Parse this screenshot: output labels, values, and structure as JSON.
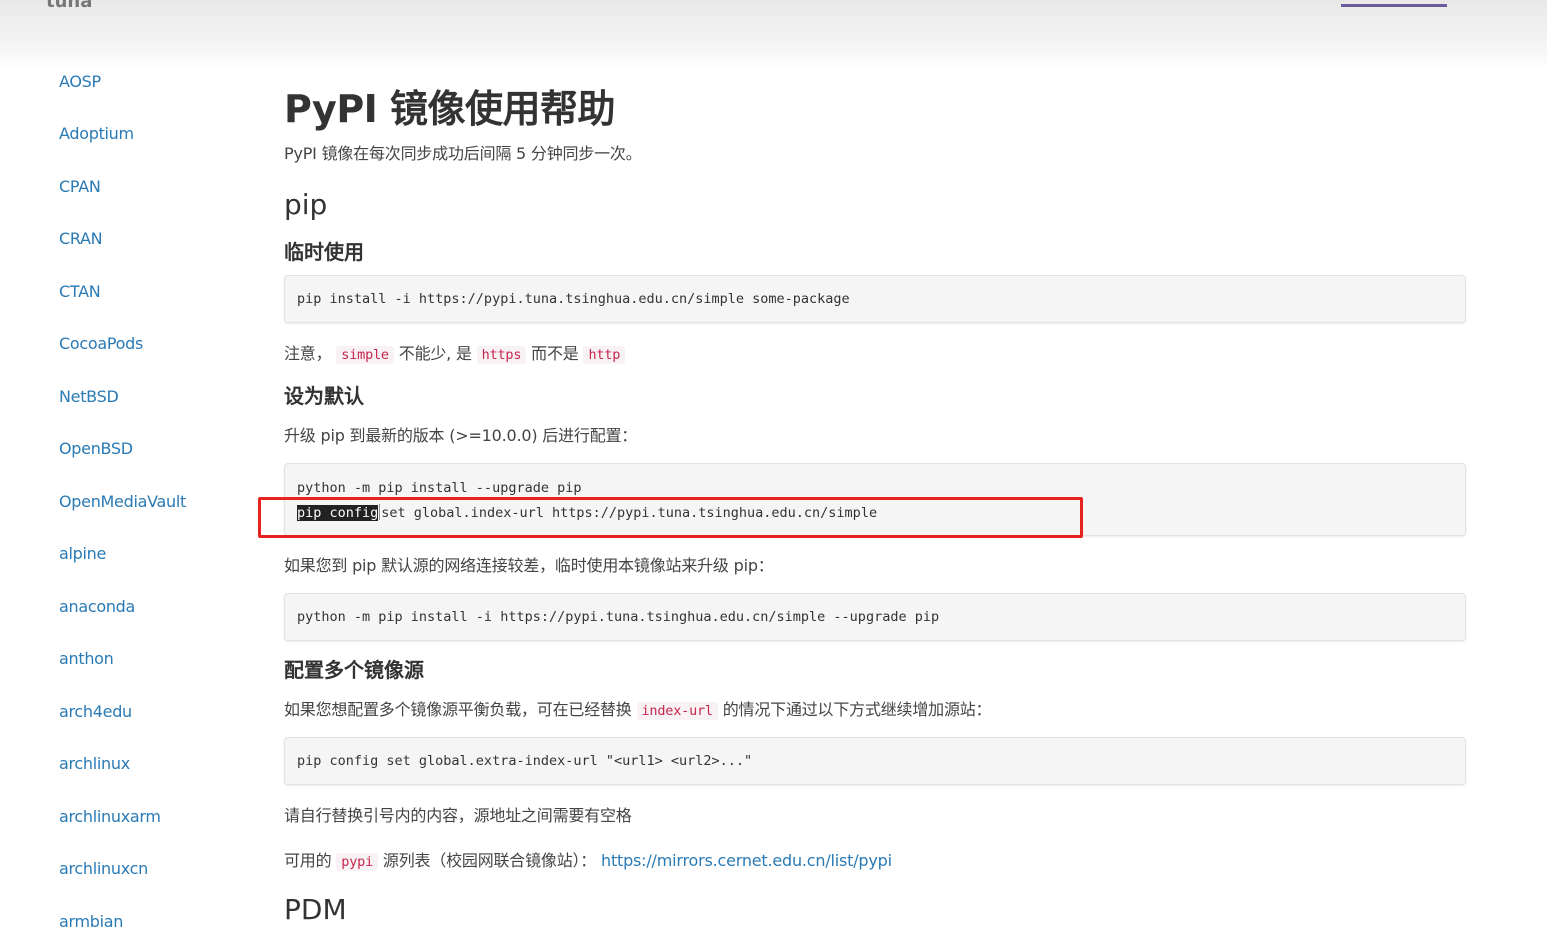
{
  "header": {
    "logo_fragment": "tuna"
  },
  "sidebar": {
    "items": [
      "AOSP",
      "Adoptium",
      "CPAN",
      "CRAN",
      "CTAN",
      "CocoaPods",
      "NetBSD",
      "OpenBSD",
      "OpenMediaVault",
      "alpine",
      "anaconda",
      "anthon",
      "arch4edu",
      "archlinux",
      "archlinuxarm",
      "archlinuxcn",
      "armbian"
    ]
  },
  "content": {
    "title": "PyPI 镜像使用帮助",
    "intro": "PyPI 镜像在每次同步成功后间隔 5 分钟同步一次。",
    "pip_heading": "pip",
    "temp_heading": "临时使用",
    "temp_code": "pip install -i https://pypi.tuna.tsinghua.edu.cn/simple some-package",
    "note": {
      "prefix": "注意，",
      "code1": "simple",
      "mid1": "不能少, 是",
      "code2": "https",
      "mid2": "而不是",
      "code3": "http"
    },
    "default_heading": "设为默认",
    "default_text": "升级 pip 到最新的版本 (>=10.0.0) 后进行配置：",
    "default_code_line1": "python -m pip install --upgrade pip",
    "default_code_line2_selected": "pip config",
    "default_code_line2_rest": "set global.index-url https://pypi.tuna.tsinghua.edu.cn/simple",
    "slow_text": "如果您到 pip 默认源的网络连接较差，临时使用本镜像站来升级 pip：",
    "slow_code": "python -m pip install -i https://pypi.tuna.tsinghua.edu.cn/simple --upgrade pip",
    "multi_heading": "配置多个镜像源",
    "multi_text": {
      "prefix": "如果您想配置多个镜像源平衡负载，可在已经替换",
      "code": "index-url",
      "suffix": "的情况下通过以下方式继续增加源站："
    },
    "multi_code": "pip config set global.extra-index-url \"<url1> <url2>...\"",
    "replace_text": "请自行替换引号内的内容，源地址之间需要有空格",
    "available": {
      "prefix": "可用的",
      "code": "pypi",
      "mid": "源列表（校园网联合镜像站）：",
      "link": "https://mirrors.cernet.edu.cn/list/pypi"
    },
    "pdm_heading": "PDM"
  },
  "colors": {
    "link": "#2a7ab5",
    "inline_code": "#c7254e",
    "highlight_box": "#e8231f"
  }
}
